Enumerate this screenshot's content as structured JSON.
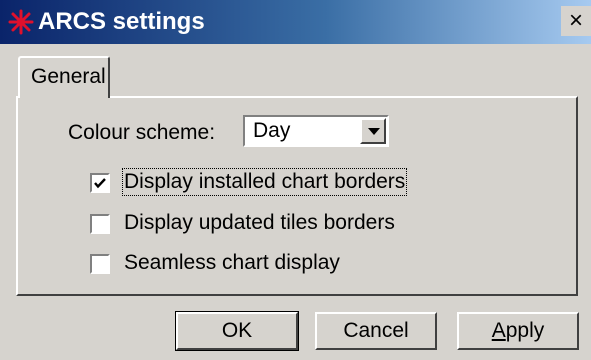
{
  "window": {
    "title": "ARCS settings",
    "close_label": "×",
    "icon": "arcs-star-icon"
  },
  "tabs": [
    {
      "label": "General",
      "selected": true
    }
  ],
  "general": {
    "colour_scheme_label": "Colour scheme:",
    "colour_scheme_value": "Day",
    "checkboxes": [
      {
        "label": "Display installed chart borders",
        "checked": true
      },
      {
        "label": "Display updated tiles borders",
        "checked": false
      },
      {
        "label": "Seamless chart display",
        "checked": false
      }
    ]
  },
  "buttons": {
    "ok": "OK",
    "cancel": "Cancel",
    "apply_first": "A",
    "apply_rest": "pply"
  },
  "colors": {
    "face": "#d6d3ce",
    "title_start": "#0a246a",
    "title_end": "#a6caf0",
    "icon_red": "#e0102c"
  }
}
